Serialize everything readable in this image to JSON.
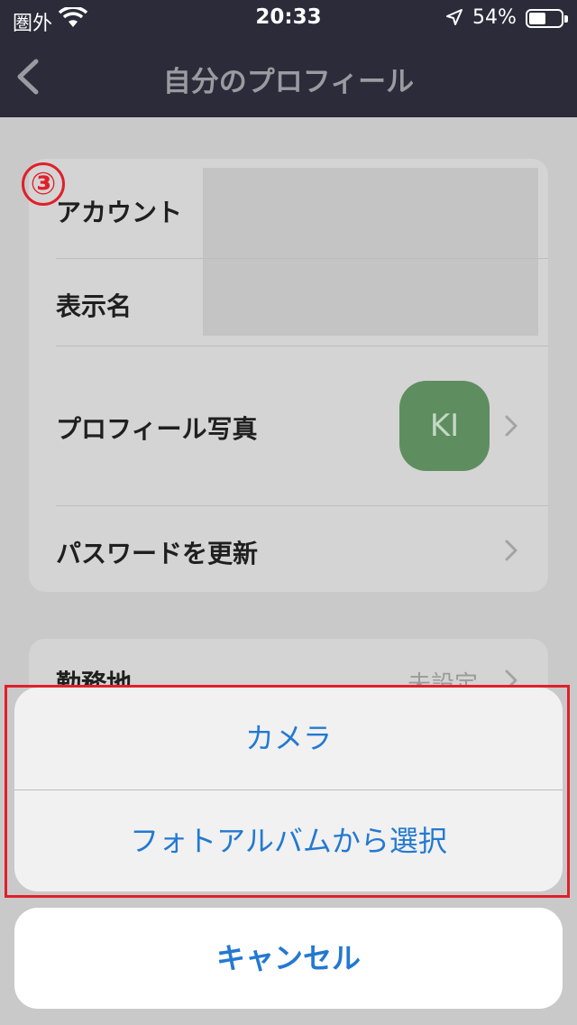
{
  "status_bar": {
    "carrier": "圏外",
    "time": "20:33",
    "battery_percent": "54%",
    "battery_level": 0.54
  },
  "nav": {
    "title": "自分のプロフィール",
    "back_icon": "chevron-left-icon"
  },
  "step_badge": "③",
  "profile": {
    "rows": [
      {
        "label": "アカウント"
      },
      {
        "label": "表示名"
      },
      {
        "label": "プロフィール写真",
        "avatar_initials": "KI"
      },
      {
        "label": "パスワードを更新"
      }
    ]
  },
  "second_section": {
    "rows": [
      {
        "label": "勤務地",
        "value": "未設定"
      }
    ]
  },
  "action_sheet": {
    "actions": [
      {
        "label": "カメラ"
      },
      {
        "label": "フォトアルバムから選択"
      }
    ],
    "cancel_label": "キャンセル"
  },
  "colors": {
    "nav_background": "#2b2b3a",
    "action_blue": "#2379d2",
    "highlight_red": "#e0202a",
    "avatar_green": "#5e8e5f"
  }
}
